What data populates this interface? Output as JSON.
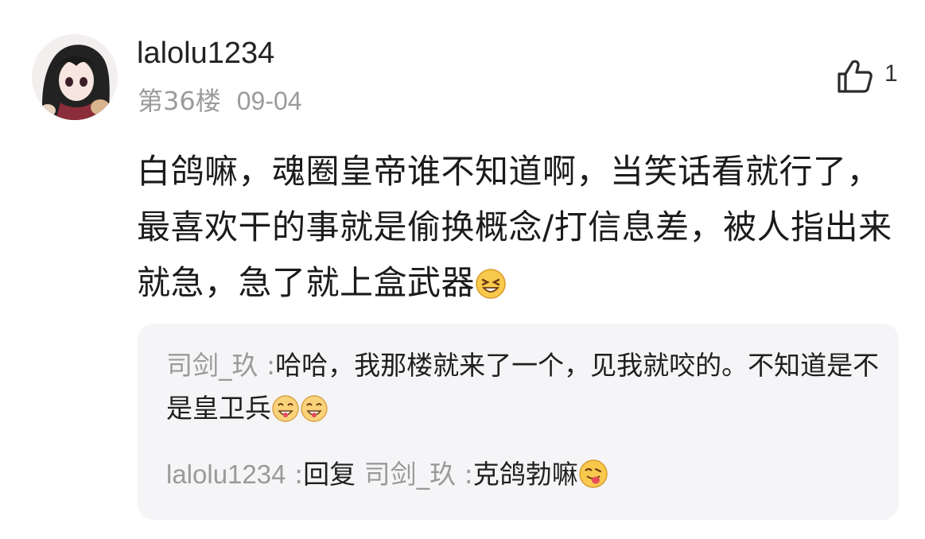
{
  "post": {
    "username": "lalolu1234",
    "floor": "第36楼",
    "date": "09-04",
    "likes": "1",
    "content": "白鸽嘛，魂圈皇帝谁不知道啊，当笑话看就行了，最喜欢干的事就是偷换概念/打信息差，被人指出来就急，急了就上盒武器"
  },
  "icons": {
    "avatar": "anime-girl-avatar",
    "like": "thumbs-up-icon",
    "emoji_laugh": "grinning-squint-emoji",
    "emoji_smile": "smiling-emoji",
    "emoji_tongue": "tongue-out-emoji"
  },
  "replies": [
    {
      "author": "司剑_玖",
      "separator": " :",
      "text": "哈哈，我那楼就来了一个，见我就咬的。不知道是不是皇卫兵"
    },
    {
      "author": "lalolu1234",
      "separator": " :",
      "reply_word": "回复",
      "target": "司剑_玖",
      "target_sep": " :",
      "text": "克鸽勃嘛"
    }
  ]
}
